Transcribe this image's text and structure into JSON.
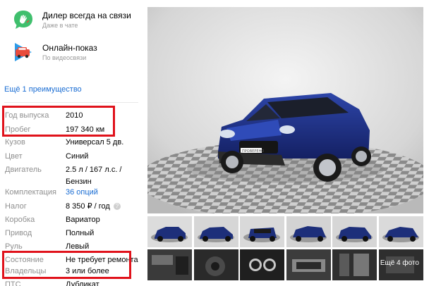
{
  "advantages": [
    {
      "title": "Дилер всегда на связи",
      "subtitle": "Даже в чате"
    },
    {
      "title": "Онлайн-показ",
      "subtitle": "По видеосвязи"
    }
  ],
  "more_link": "Ещё 1 преимущество",
  "specs": [
    {
      "key": "Год выпуска",
      "value": "2010"
    },
    {
      "key": "Пробег",
      "value": "197 340 км"
    },
    {
      "key": "Кузов",
      "value": "Универсал 5 дв."
    },
    {
      "key": "Цвет",
      "value": "Синий"
    },
    {
      "key": "Двигатель",
      "value": "2.5 л / 167 л.с. /",
      "value2": "Бензин"
    },
    {
      "key": "Комплектация",
      "value": "36 опций"
    },
    {
      "key": "Налог",
      "value": "8 350 ₽ / год"
    },
    {
      "key": "Коробка",
      "value": "Вариатор"
    },
    {
      "key": "Привод",
      "value": "Полный"
    },
    {
      "key": "Руль",
      "value": "Левый"
    },
    {
      "key": "Состояние",
      "value": "Не требует ремонта"
    },
    {
      "key": "Владельцы",
      "value": "3 или более"
    },
    {
      "key": "ПТС",
      "value": "Дубликат"
    }
  ],
  "help_glyph": "?",
  "gallery": {
    "plate_text": "ПРОВЕРЕНО",
    "more_photos": "Ещё 4 фото"
  },
  "colors": {
    "link": "#1a6dd3",
    "highlight": "#e0121b",
    "car_body": "#1d2f7a"
  },
  "icons": [
    "chat-bubble-icon",
    "video-play-car-icon",
    "help-icon"
  ]
}
